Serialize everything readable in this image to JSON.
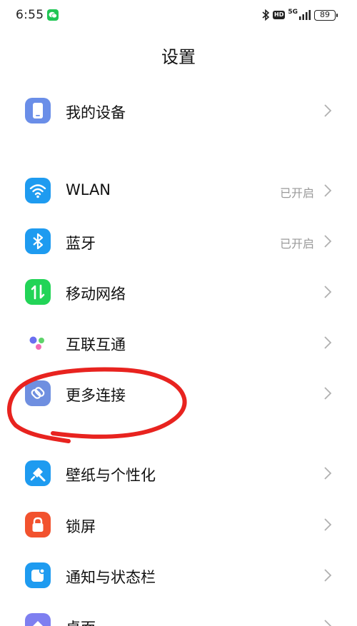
{
  "status": {
    "time": "6:55",
    "hd": "HD",
    "network": "5G",
    "battery": "89"
  },
  "title": "设置",
  "items": [
    {
      "label": "我的设备",
      "value": "",
      "icon": "phone-icon",
      "color": "#6a8ee8"
    },
    {
      "label": "WLAN",
      "value": "已开启",
      "icon": "wifi-icon",
      "color": "#1e9bf0"
    },
    {
      "label": "蓝牙",
      "value": "已开启",
      "icon": "bluetooth-icon",
      "color": "#1e9bf0"
    },
    {
      "label": "移动网络",
      "value": "",
      "icon": "mobile-data-icon",
      "color": "#22d457"
    },
    {
      "label": "互联互通",
      "value": "",
      "icon": "interconnect-icon",
      "color": "#ffffff"
    },
    {
      "label": "更多连接",
      "value": "",
      "icon": "link-icon",
      "color": "#6f8fe0"
    },
    {
      "label": "壁纸与个性化",
      "value": "",
      "icon": "wallpaper-icon",
      "color": "#1e9bf0"
    },
    {
      "label": "锁屏",
      "value": "",
      "icon": "lock-icon",
      "color": "#f2522e"
    },
    {
      "label": "通知与状态栏",
      "value": "",
      "icon": "notification-icon",
      "color": "#1e9bf0"
    },
    {
      "label": "桌面",
      "value": "",
      "icon": "home-icon",
      "color": "#7e7ff0"
    }
  ],
  "annotation_color": "#e8231f"
}
